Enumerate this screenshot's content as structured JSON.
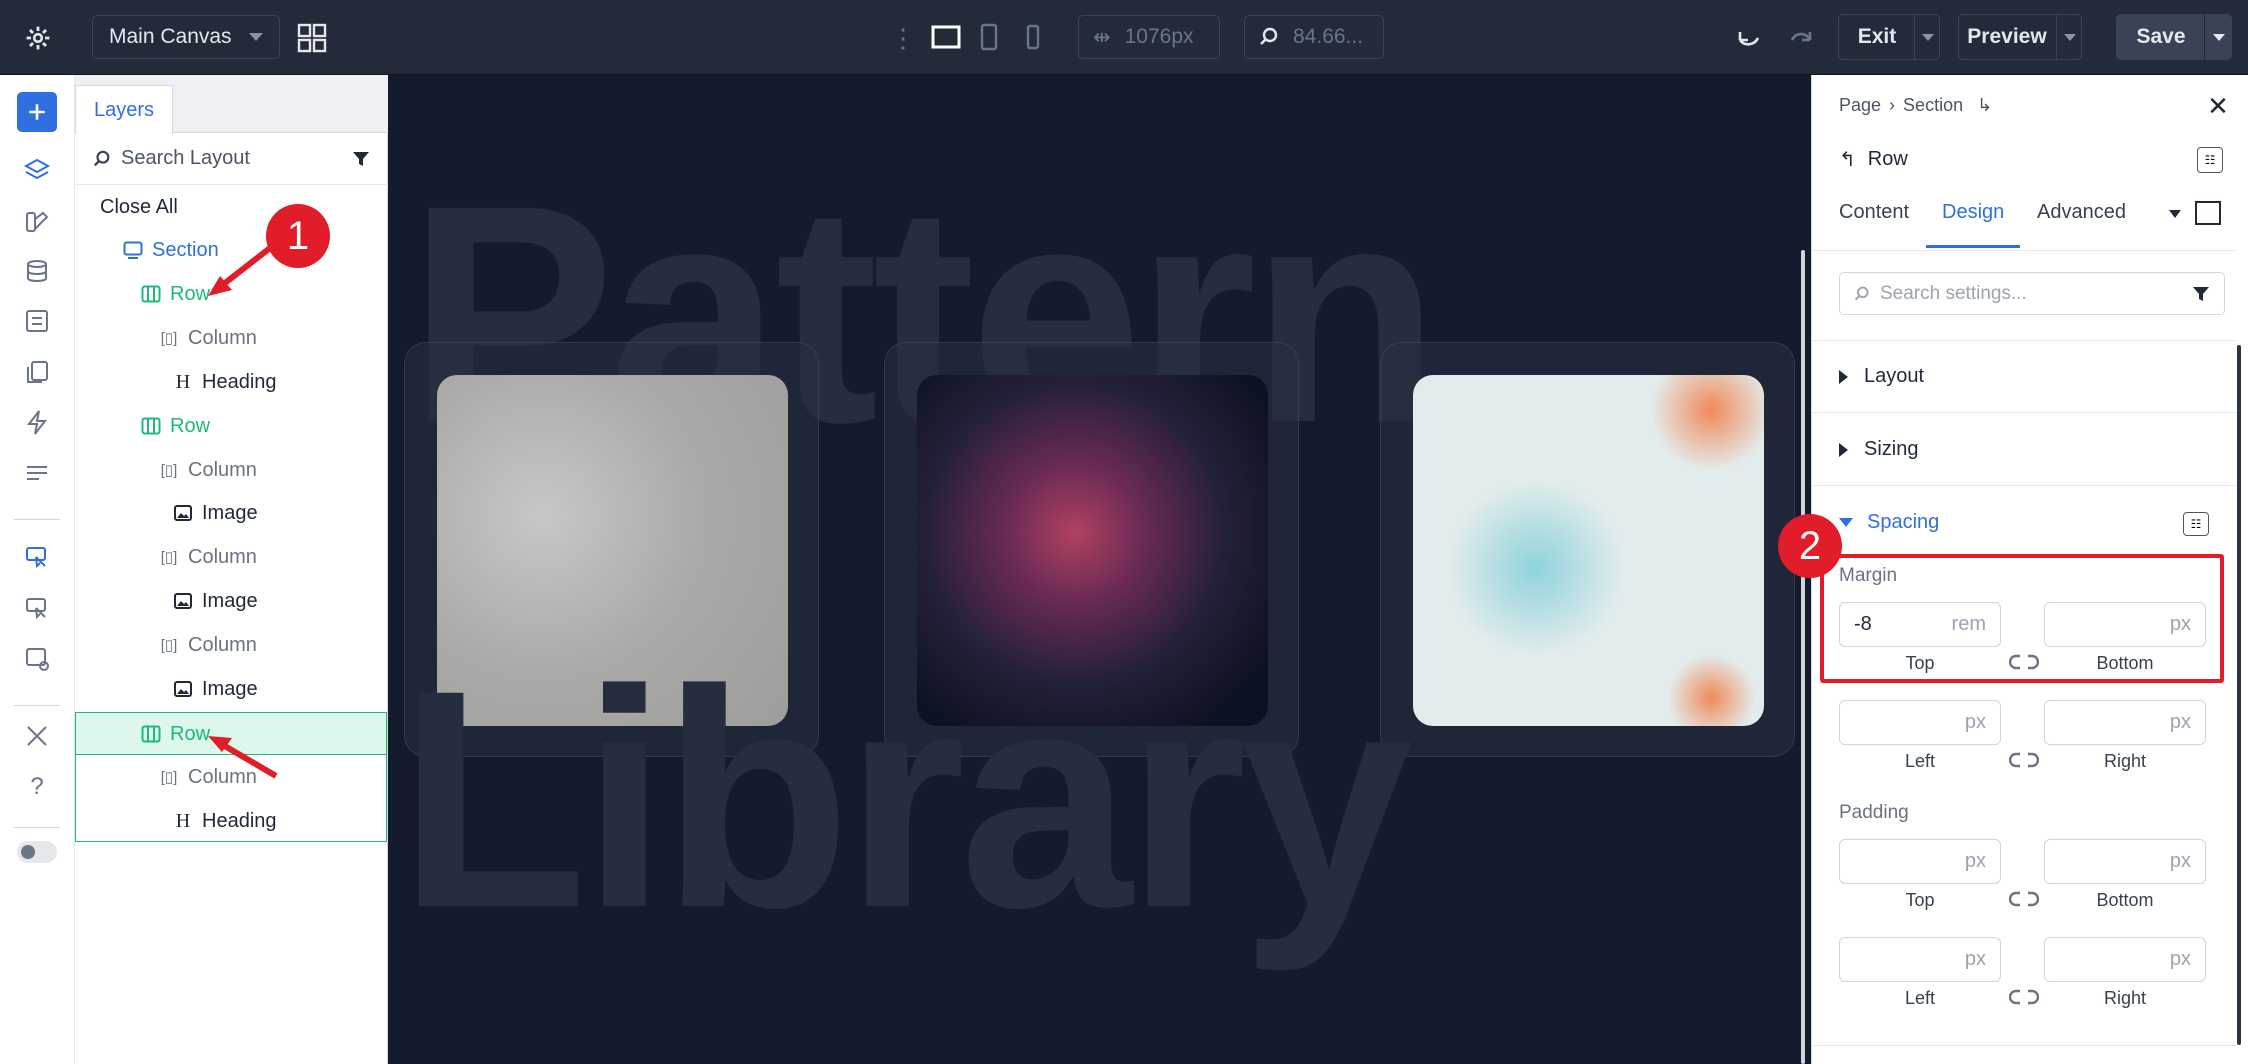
{
  "topbar": {
    "canvas_select": "Main Canvas",
    "width_value": "1076px",
    "zoom_value": "84.66...",
    "exit_label": "Exit",
    "preview_label": "Preview",
    "save_label": "Save"
  },
  "layers": {
    "tab_label": "Layers",
    "search_placeholder": "Search Layout",
    "close_all": "Close All",
    "items": [
      {
        "label": "Section",
        "type": "section"
      },
      {
        "label": "Row",
        "type": "row"
      },
      {
        "label": "Column",
        "type": "column"
      },
      {
        "label": "Heading",
        "type": "heading"
      },
      {
        "label": "Row",
        "type": "row"
      },
      {
        "label": "Column",
        "type": "column"
      },
      {
        "label": "Image",
        "type": "image"
      },
      {
        "label": "Column",
        "type": "column"
      },
      {
        "label": "Image",
        "type": "image"
      },
      {
        "label": "Column",
        "type": "column"
      },
      {
        "label": "Image",
        "type": "image"
      },
      {
        "label": "Row",
        "type": "row"
      },
      {
        "label": "Column",
        "type": "column"
      },
      {
        "label": "Heading",
        "type": "heading"
      }
    ]
  },
  "canvas": {
    "heading_line1": "Pattern",
    "heading_line2": "Library"
  },
  "annotations": {
    "badge1": "1",
    "badge2": "2"
  },
  "settings": {
    "breadcrumb": [
      "Page",
      "Section"
    ],
    "element_title": "Row",
    "tabs": [
      "Content",
      "Design",
      "Advanced"
    ],
    "active_tab": "Design",
    "search_placeholder": "Search settings...",
    "sections": {
      "layout": "Layout",
      "sizing": "Sizing",
      "spacing": "Spacing"
    },
    "margin": {
      "label": "Margin",
      "top_value": "-8",
      "top_unit": "rem",
      "bottom_unit": "px",
      "left_unit": "px",
      "right_unit": "px",
      "top_label": "Top",
      "bottom_label": "Bottom",
      "left_label": "Left",
      "right_label": "Right"
    },
    "padding": {
      "label": "Padding",
      "top_unit": "px",
      "bottom_unit": "px",
      "left_unit": "px",
      "right_unit": "px",
      "top_label": "Top",
      "bottom_label": "Bottom",
      "left_label": "Left",
      "right_label": "Right"
    }
  },
  "colors": {
    "accent_blue": "#2f6fe0",
    "row_green": "#20b87a",
    "annotation_red": "#e11d2a",
    "save_bg": "#3a4356"
  }
}
